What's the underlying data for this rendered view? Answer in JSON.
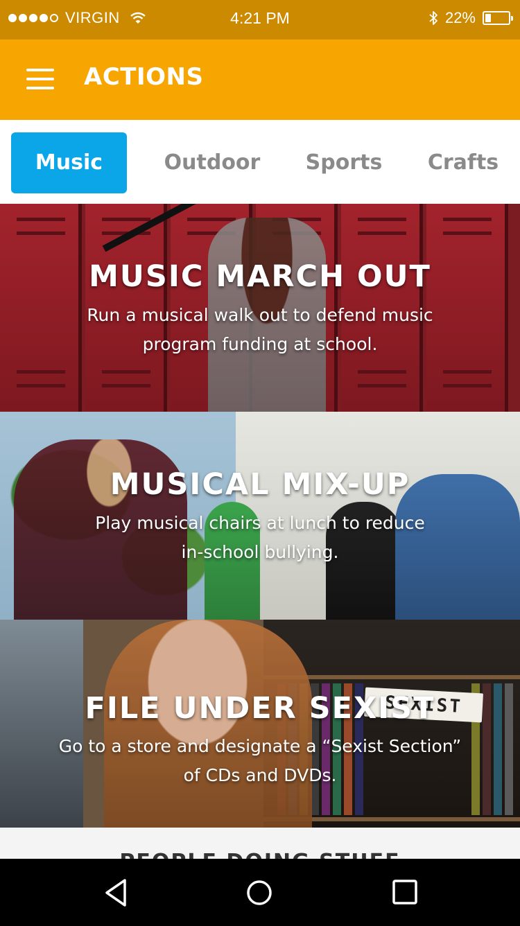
{
  "status_bar": {
    "carrier": "VIRGIN",
    "time": "4:21 PM",
    "battery": "22%",
    "battery_level": 0.22,
    "signal_dots_filled": 4,
    "signal_dots_total": 5,
    "icons": [
      "wifi-icon",
      "bluetooth-icon",
      "battery-icon"
    ]
  },
  "app_bar": {
    "title": "ACTIONS",
    "menu_icon": "menu-icon"
  },
  "tabs": [
    {
      "label": "Music",
      "active": true
    },
    {
      "label": "Outdoor",
      "active": false
    },
    {
      "label": "Sports",
      "active": false
    },
    {
      "label": "Crafts",
      "active": false
    }
  ],
  "cards": [
    {
      "title": "MUSIC MARCH OUT",
      "desc_line1": "Run a musical walk out to defend music",
      "desc_line2": "program funding at school."
    },
    {
      "title": "MUSICAL MIX-UP",
      "desc_line1": "Play musical chairs at lunch to reduce",
      "desc_line2": "in-school bullying."
    },
    {
      "title": "FILE UNDER SEXIST",
      "desc_line1": "Go to a store and designate a “Sexist Section”",
      "desc_line2": "of CDs and DVDs.",
      "sign_text": "SEXIST"
    }
  ],
  "section": {
    "heading": "PEOPLE DOING STUFF"
  },
  "colors": {
    "status_bar": "#cc8a00",
    "app_bar": "#f7a500",
    "active_tab": "#0aa6e8",
    "inactive_tab_text": "#8a8a8a"
  },
  "nav_bar": {
    "icons": [
      "back-icon",
      "home-icon",
      "recents-icon"
    ]
  }
}
